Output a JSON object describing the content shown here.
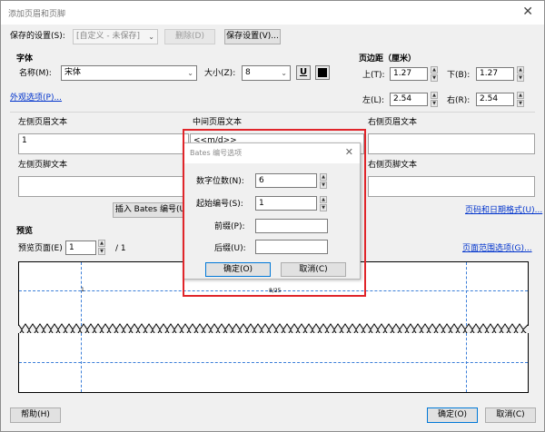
{
  "window": {
    "title": "添加页眉和页脚",
    "close": "✕"
  },
  "saved_settings": {
    "label": "保存的设置(S):",
    "value": "[自定义 - 未保存]",
    "delete_label": "删除(D)",
    "save_label": "保存设置(V)..."
  },
  "font": {
    "group_label": "字体",
    "name_label": "名称(M):",
    "name_value": "宋体",
    "size_label": "大小(Z):",
    "size_value": "8",
    "underline": "U",
    "appearance_link": "外观选项(P)..."
  },
  "margins": {
    "group_label": "页边距（厘米）",
    "top_label": "上(T):",
    "top_value": "1.27",
    "bottom_label": "下(B):",
    "bottom_value": "1.27",
    "left_label": "左(L):",
    "left_value": "2.54",
    "right_label": "右(R):",
    "right_value": "2.54"
  },
  "header_footer": {
    "left_header_label": "左侧页眉文本",
    "left_header_value": "1",
    "center_header_label": "中间页眉文本",
    "center_header_value": "<<m/d>>",
    "right_header_label": "右侧页眉文本",
    "left_footer_label": "左侧页脚文本",
    "right_footer_label": "右侧页脚文本",
    "insert_bates": "插入 Bates 编号(U)...",
    "page_number_link": "页码和日期格式(U)..."
  },
  "preview": {
    "group_label": "预览",
    "page_label": "预览页面(E)",
    "page_value": "1",
    "page_total": "/ 1",
    "range_link": "页面范围选项(G)...",
    "left_text": "1",
    "center_text": "8/25"
  },
  "bates": {
    "title": "Bates 编号选项",
    "close": "✕",
    "digits_label": "数字位数(N):",
    "digits_value": "6",
    "start_label": "起始编号(S):",
    "start_value": "1",
    "prefix_label": "前缀(P):",
    "prefix_value": "",
    "suffix_label": "后缀(U):",
    "suffix_value": "",
    "ok_label": "确定(O)",
    "cancel_label": "取消(C)"
  },
  "footer": {
    "help_label": "帮助(H)",
    "ok_label": "确定(O)",
    "cancel_label": "取消(C)"
  },
  "colors": {
    "highlight": "#e0252a",
    "link": "#0033cc",
    "guide": "#3c7fd9"
  }
}
